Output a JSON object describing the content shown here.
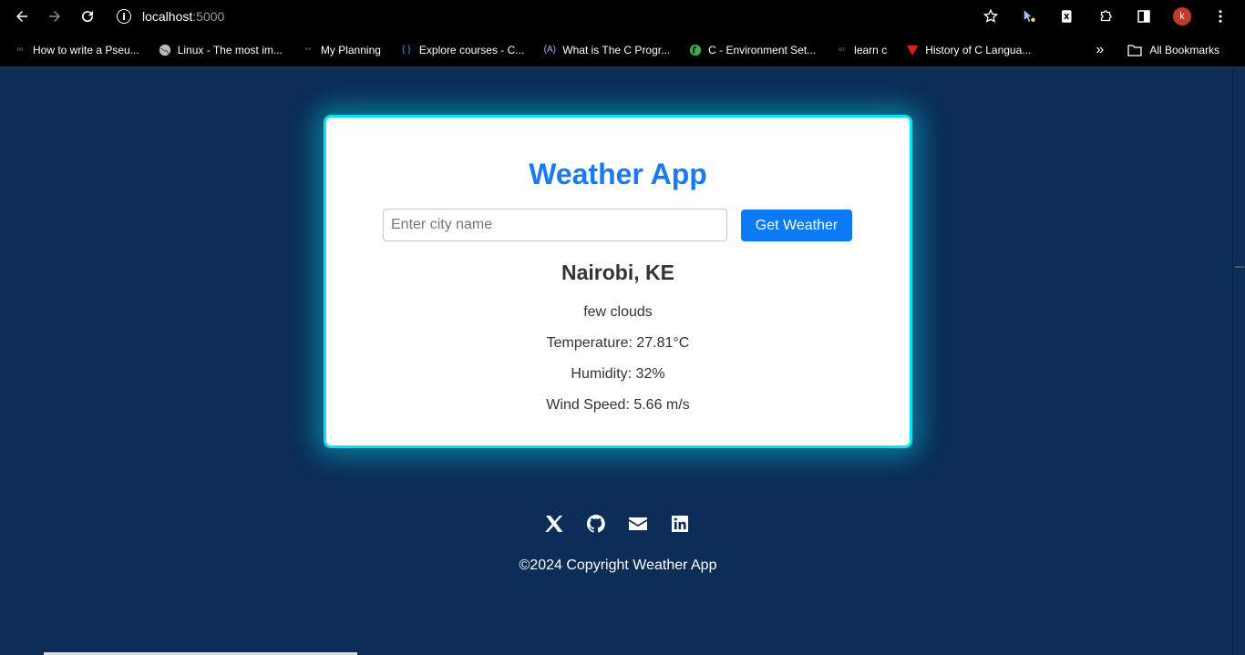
{
  "browser": {
    "url_host": "localhost",
    "url_port": ":5000",
    "avatar_letter": "k",
    "bookmarks": [
      {
        "label": "How to write a Pseu..."
      },
      {
        "label": "Linux - The most im..."
      },
      {
        "label": "My Planning"
      },
      {
        "label": "Explore courses - C..."
      },
      {
        "label": "What is The C Progr..."
      },
      {
        "label": "C - Environment Set..."
      },
      {
        "label": "learn c"
      },
      {
        "label": "History of C Langua..."
      }
    ],
    "more_label": "»",
    "all_bookmarks": "All Bookmarks"
  },
  "app": {
    "title": "Weather App",
    "search": {
      "placeholder": "Enter city name",
      "button": "Get Weather"
    },
    "weather": {
      "city": "Nairobi, KE",
      "description": "few clouds",
      "temperature": "Temperature: 27.81°C",
      "humidity": "Humidity: 32%",
      "wind": "Wind Speed: 5.66 m/s"
    },
    "footer": {
      "copyright": "©2024 Copyright Weather App",
      "social": [
        "x-icon",
        "github-icon",
        "email-icon",
        "linkedin-icon"
      ]
    }
  },
  "colors": {
    "page_bg": "#0b2d58",
    "accent": "#1a7bf0",
    "button": "#0b7bf5",
    "glow": "#00e5f0"
  }
}
